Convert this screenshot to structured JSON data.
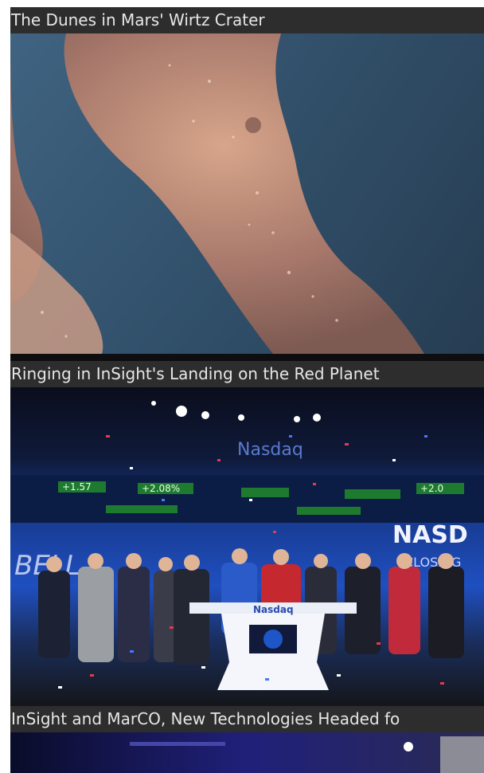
{
  "feed": {
    "items": [
      {
        "caption": "The Dunes in Mars' Wirtz Crater",
        "image_icon": "mars-dunes-photo"
      },
      {
        "caption": "Ringing in InSight's Landing on the Red Planet",
        "image_icon": "nasdaq-celebration-photo",
        "photo_text": {
          "banner": "Nasdaq",
          "wall_left": "BELL",
          "wall_right_top": "NASD",
          "wall_right_bottom": "CLOSING",
          "podium": "Nasdaq",
          "ticker_1": "+1.57",
          "ticker_2": "+2.08%",
          "ticker_3": "+2.0"
        }
      },
      {
        "caption": "InSight and MarCO, New Technologies Headed fo",
        "image_icon": "spacecraft-photo"
      }
    ]
  },
  "colors": {
    "caption_bg": "#2d2d2d",
    "caption_text": "#e6e6e6",
    "mars_blue": "#3a5670",
    "mars_sand": "#b88a70",
    "stage_blue": "#1a3fa6"
  }
}
